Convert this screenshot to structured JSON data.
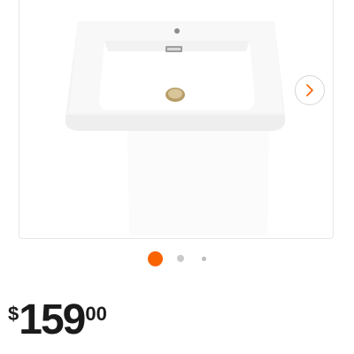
{
  "product": {
    "image_icon": "sink-image",
    "gallery": {
      "next_icon": "chevron-right-icon",
      "dots_count": 3,
      "active_index": 0,
      "colors": {
        "active": "#f96302",
        "inactive": "#c9c9c9",
        "chevron": "#f96302"
      }
    },
    "price": {
      "currency": "$",
      "dollars": "159",
      "cents": "00"
    }
  }
}
